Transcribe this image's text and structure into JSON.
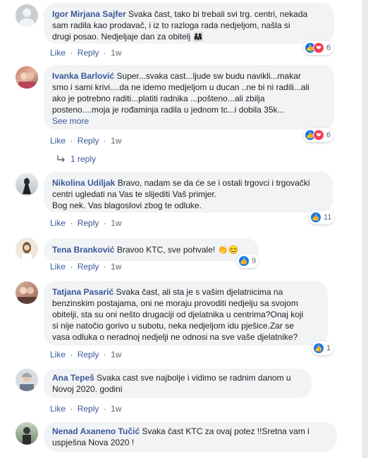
{
  "actions": {
    "like": "Like",
    "reply": "Reply",
    "sep": "·"
  },
  "comments": [
    {
      "name": "Igor Mirjana Sajfer",
      "text_lines": [
        "Svaka čast, tako bi trebali svi trg. centri, nekada",
        "sam radila kao prodavač, i iz to razloga rada nedjeljom, našla si",
        "drugi posao. Nedjeljaje dan za obitelj"
      ],
      "emoji": "👨‍👩‍👧",
      "time": "1w",
      "reaction_count": "6",
      "reactions": [
        "like",
        "love"
      ]
    },
    {
      "name": "Ivanka Barlović",
      "text_lines": [
        "Super...svaka cast...ljude sw budu navikli...makar",
        "smo i sami krivi....da ne idemo medjeljom u ducan ..ne bi ni radili...ali",
        "ako je potrebno raditi...platiti radnika ...pošteno...ali zbilja",
        "posteno....moja je rođaminja radila u jednom tc...i dobila 35k..."
      ],
      "see_more": "See more",
      "time": "1w",
      "reaction_count": "6",
      "reactions": [
        "like",
        "love"
      ],
      "replies": "1 reply"
    },
    {
      "name": "Nikolina Udiljak",
      "text_lines": [
        "Bravo, nadam se da će se i ostali trgovci i trgovački",
        "centri ugledati na Vas te slijediti Vaš primjer.",
        "Bog nek. Vas blagoslovi zbog te odluke."
      ],
      "time": "1w",
      "reaction_count": "11",
      "reactions": [
        "like"
      ]
    },
    {
      "name": "Tena Branković",
      "text_lines": [
        "Bravoo KTC, sve pohvale!"
      ],
      "emoji": "👏😊",
      "time": "1w",
      "reaction_count": "9",
      "reactions": [
        "like"
      ]
    },
    {
      "name": "Tatjana Pasarić",
      "text_lines": [
        "Svaka čast, ali sta je s vašim djelatnicima na",
        "benzinskim postajama, oni ne moraju provoditi nedjelju sa svojom",
        "obitelji, sta su oni nešto drugaciji od djelatnika u centrima?Onaj koji",
        "si nije natočio gorivo u subotu, neka nedjeljom idu pješice.Zar se",
        "vasa odluka o neradnoj nedjelji ne odnosi na sve vaše djelatnike?"
      ],
      "time": "1w",
      "reaction_count": "1",
      "reactions": [
        "like"
      ]
    },
    {
      "name": "Ana Tepeš",
      "text_lines": [
        "Svaka cast sve najbolje i vidimo se radnim danom u",
        "Novoj 2020. godini"
      ],
      "time": "1w"
    },
    {
      "name": "Nenad Axaneno Tučić",
      "text_lines": [
        "Svaka čast KTC za ovaj potez !!Sretna vam i",
        "uspješna Nova 2020 !"
      ]
    }
  ],
  "colors": {
    "name": "#385898",
    "bubble": "#f2f3f5",
    "like": "#1877f2",
    "love": "#f33e58"
  }
}
